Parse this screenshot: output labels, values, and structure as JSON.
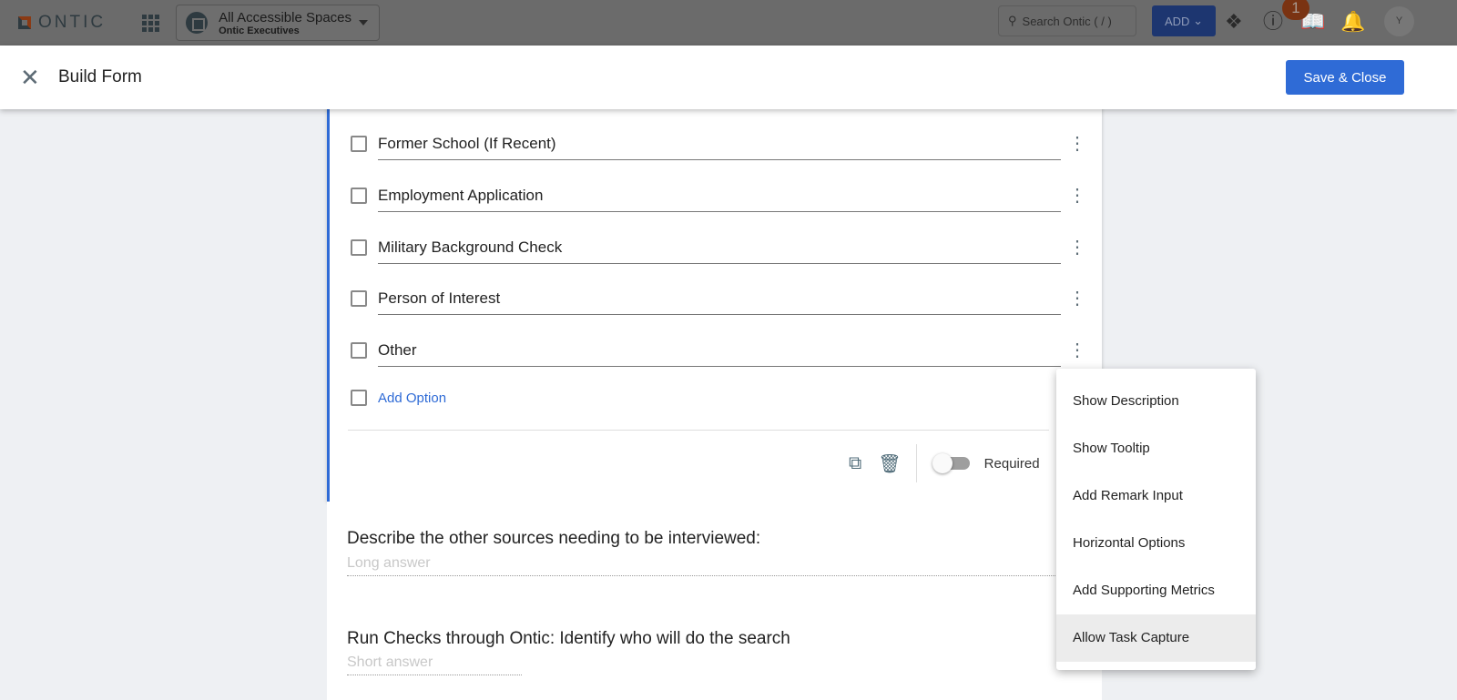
{
  "topbar": {
    "brand": "ONTIC",
    "space_title": "All Accessible Spaces",
    "space_sub": "Ontic Executives",
    "search_placeholder": "Search Ontic ( / )",
    "add_label": "ADD",
    "notification_count": "1",
    "avatar": "Y"
  },
  "header": {
    "title": "Build Form",
    "save_label": "Save & Close"
  },
  "card": {
    "options": [
      "Former School (If Recent)",
      "Employment Application",
      "Military Background Check",
      "Person of Interest",
      "Other"
    ],
    "add_option": "Add Option",
    "required_label": "Required",
    "required": false
  },
  "questions": [
    {
      "title": "Describe the other sources needing to be interviewed:",
      "placeholder": "Long answer"
    },
    {
      "title": "Run Checks through Ontic: Identify who will do the search",
      "placeholder": "Short answer"
    }
  ],
  "menu": {
    "items": [
      "Show Description",
      "Show Tooltip",
      "Add Remark Input",
      "Horizontal Options",
      "Add Supporting Metrics",
      "Allow Task Capture"
    ]
  }
}
